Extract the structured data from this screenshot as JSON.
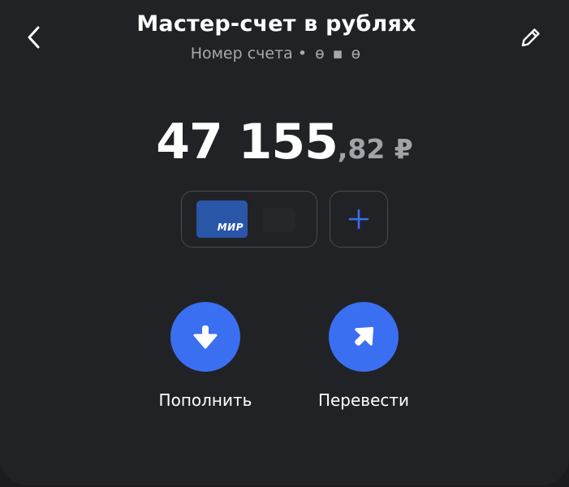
{
  "header": {
    "title": "Мастер-счет в рублях",
    "subtitle_prefix": "Номер счета",
    "subtitle_mask": "• ө ▪ ө",
    "back_icon": "chevron-left-icon",
    "edit_icon": "pencil-icon"
  },
  "balance": {
    "integer": "47 155",
    "fraction": ",82 ₽"
  },
  "cards": {
    "card_brand": "МИР",
    "card_color": "#2a56a8",
    "add_icon": "plus-icon"
  },
  "actions": [
    {
      "label": "Пополнить",
      "icon": "arrow-down-icon"
    },
    {
      "label": "Перевести",
      "icon": "arrow-up-right-icon"
    }
  ],
  "colors": {
    "background": "#212226",
    "accent": "#3a6ff2",
    "text_primary": "#ffffff",
    "text_secondary": "#a7a8ad"
  }
}
